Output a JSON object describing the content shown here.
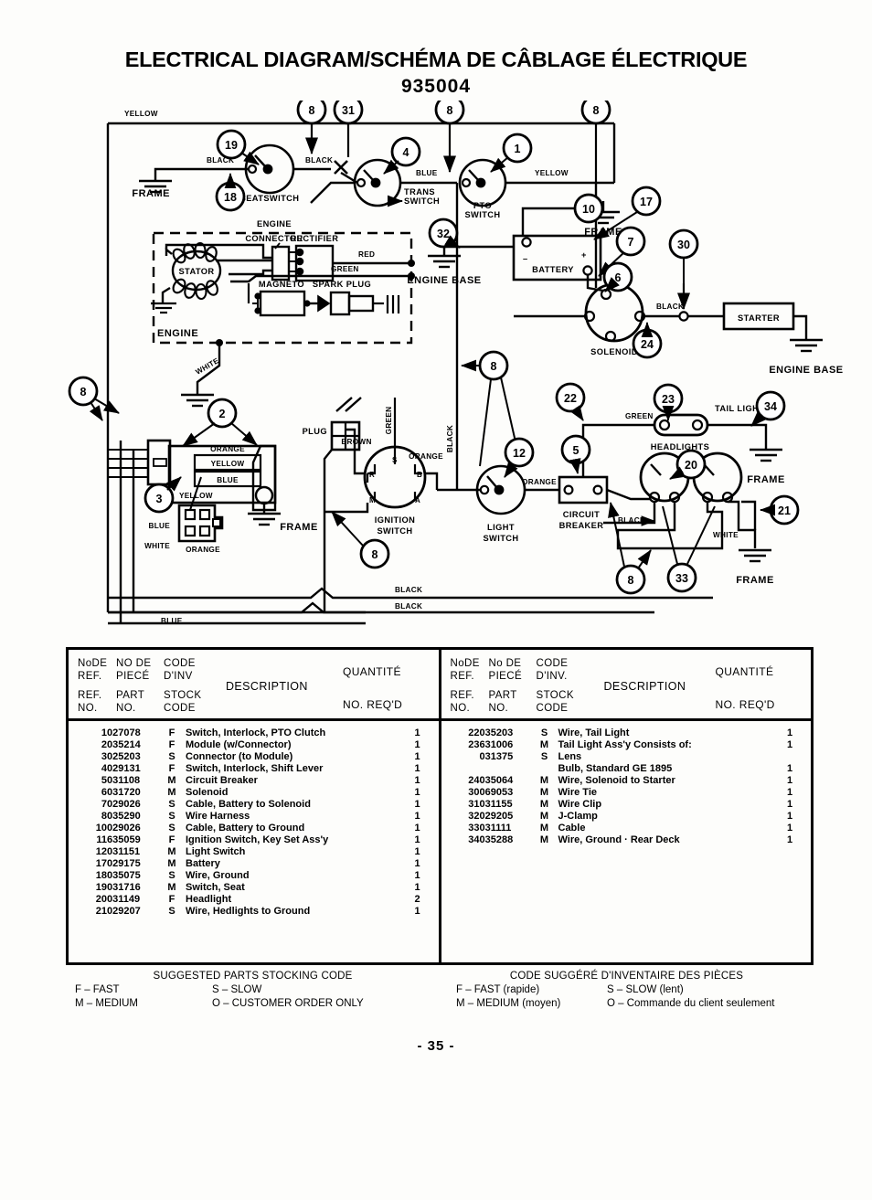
{
  "document": {
    "title": "ELECTRICAL DIAGRAM/SCHÉMA DE CÂBLAGE ÉLECTRIQUE",
    "number": "935004",
    "page_number": "- 35 -"
  },
  "diagram": {
    "components": [
      {
        "id": "seat-switch",
        "label": "SEATSWITCH"
      },
      {
        "id": "trans-switch",
        "label": "TRANS\nSWITCH"
      },
      {
        "id": "pto-switch",
        "label": "PTO\nSWITCH"
      },
      {
        "id": "battery",
        "label": "BATTERY"
      },
      {
        "id": "solenoid",
        "label": "SOLENOID"
      },
      {
        "id": "starter",
        "label": "STARTER"
      },
      {
        "id": "engine",
        "label": "ENGINE"
      },
      {
        "id": "engine-box",
        "label": "ENGINE"
      },
      {
        "id": "connector",
        "label": "CONNECTOR"
      },
      {
        "id": "rectifier",
        "label": "RECTIFIER"
      },
      {
        "id": "stator",
        "label": "STATOR"
      },
      {
        "id": "magneto",
        "label": "MAGNETO"
      },
      {
        "id": "spark-plug",
        "label": "SPARK PLUG"
      },
      {
        "id": "ignition-switch",
        "label": "IGNITION\nSWITCH"
      },
      {
        "id": "light-switch",
        "label": "LIGHT\nSWITCH"
      },
      {
        "id": "circuit-breaker",
        "label": "CIRCUIT\nBREAKER"
      },
      {
        "id": "tail-light",
        "label": "TAIL LIGHT"
      },
      {
        "id": "headlights",
        "label": "HEADLIGHTS"
      },
      {
        "id": "plug",
        "label": "PLUG"
      }
    ],
    "labels": {
      "frame": "FRAME",
      "engine_base": "ENGINE BASE",
      "yellow": "YELLOW",
      "black": "BLACK",
      "orange": "ORANGE",
      "blue": "BLUE",
      "red": "RED",
      "green": "GREEN",
      "white": "WHITE",
      "brown": "BROWN"
    },
    "ignition_terminals": [
      "R",
      "S",
      "B",
      "M",
      "A"
    ],
    "balloons": [
      "1",
      "2",
      "3",
      "4",
      "5",
      "6",
      "7",
      "8",
      "10",
      "12",
      "17",
      "18",
      "19",
      "20",
      "21",
      "22",
      "23",
      "24",
      "30",
      "31",
      "32",
      "33",
      "34"
    ]
  },
  "parts_table": {
    "headers": {
      "line1_col1": "NoDE",
      "line1_col2": "NO DE",
      "line1_col3": "CODE",
      "line2_col1": "REF.",
      "line2_col2": "PIECÉ",
      "line2_col3": "D'INV",
      "line3_col1": "REF.",
      "line3_col2": "PART",
      "line3_col3": "STOCK",
      "line4_col1": "NO.",
      "line4_col2": "NO.",
      "line4_col3": "CODE",
      "description": "DESCRIPTION",
      "quantite": "QUANTITÉ",
      "no_reqd": "NO. REQ'D"
    },
    "headers_right": {
      "line1_col1": "NoDE",
      "line1_col2": "No DE",
      "line1_col3": "CODE",
      "line2_col1": "REF.",
      "line2_col2": "PIECÉ",
      "line2_col3": "D'INV.",
      "line3_col1": "REF.",
      "line3_col2": "PART",
      "line3_col3": "STOCK",
      "line4_col1": "NO.",
      "line4_col2": "NO.",
      "line4_col3": "CODE",
      "description": "DESCRIPTION",
      "quantite": "QUANTITÉ",
      "no_reqd": "NO. REQ'D"
    },
    "left_rows": [
      {
        "ref": "1",
        "part": "027078",
        "code": "F",
        "desc": "Switch, Interlock, PTO Clutch",
        "qty": "1"
      },
      {
        "ref": "2",
        "part": "035214",
        "code": "F",
        "desc": "Module (w/Connector)",
        "qty": "1"
      },
      {
        "ref": "3",
        "part": "025203",
        "code": "S",
        "desc": "Connector (to Module)",
        "qty": "1"
      },
      {
        "ref": "4",
        "part": "029131",
        "code": "F",
        "desc": "Switch, Interlock, Shift Lever",
        "qty": "1"
      },
      {
        "ref": "5",
        "part": "031108",
        "code": "M",
        "desc": "Circuit Breaker",
        "qty": "1"
      },
      {
        "ref": "6",
        "part": "031720",
        "code": "M",
        "desc": "Solenoid",
        "qty": "1"
      },
      {
        "ref": "7",
        "part": "029026",
        "code": "S",
        "desc": "Cable, Battery to Solenoid",
        "qty": "1"
      },
      {
        "ref": "8",
        "part": "035290",
        "code": "S",
        "desc": "Wire Harness",
        "qty": "1"
      },
      {
        "ref": "10",
        "part": "029026",
        "code": "S",
        "desc": "Cable, Battery to Ground",
        "qty": "1"
      },
      {
        "ref": "11",
        "part": "635059",
        "code": "F",
        "desc": "Ignition Switch, Key Set Ass'y",
        "qty": "1"
      },
      {
        "ref": "12",
        "part": "031151",
        "code": "M",
        "desc": "Light Switch",
        "qty": "1"
      },
      {
        "ref": "17",
        "part": "029175",
        "code": "M",
        "desc": "Battery",
        "qty": "1"
      },
      {
        "ref": "18",
        "part": "035075",
        "code": "S",
        "desc": "Wire, Ground",
        "qty": "1"
      },
      {
        "ref": "19",
        "part": "031716",
        "code": "M",
        "desc": "Switch, Seat",
        "qty": "1"
      },
      {
        "ref": "20",
        "part": "031149",
        "code": "F",
        "desc": "Headlight",
        "qty": "2"
      },
      {
        "ref": "21",
        "part": "029207",
        "code": "S",
        "desc": "Wire, Hedlights to Ground",
        "qty": "1"
      }
    ],
    "right_rows": [
      {
        "ref": "22",
        "part": "035203",
        "code": "S",
        "desc": "Wire, Tail Light",
        "qty": "1"
      },
      {
        "ref": "23",
        "part": "631006",
        "code": "M",
        "desc": "Tail Light Ass'y Consists of:",
        "qty": "1"
      },
      {
        "ref": "",
        "part": "031375",
        "code": "S",
        "desc": "Lens",
        "qty": ""
      },
      {
        "ref": "",
        "part": "",
        "code": "",
        "desc": "Bulb, Standard GE 1895",
        "qty": "1"
      },
      {
        "ref": "24",
        "part": "035064",
        "code": "M",
        "desc": "Wire, Solenoid to Starter",
        "qty": "1"
      },
      {
        "ref": "30",
        "part": "069053",
        "code": "M",
        "desc": "Wire Tie",
        "qty": "1"
      },
      {
        "ref": "31",
        "part": "031155",
        "code": "M",
        "desc": "Wire Clip",
        "qty": "1"
      },
      {
        "ref": "32",
        "part": "029205",
        "code": "M",
        "desc": "J-Clamp",
        "qty": "1"
      },
      {
        "ref": "33",
        "part": "031111",
        "code": "M",
        "desc": "Cable",
        "qty": "1"
      },
      {
        "ref": "34",
        "part": "035288",
        "code": "M",
        "desc": "Wire, Ground · Rear Deck",
        "qty": "1"
      }
    ]
  },
  "legend": {
    "english": {
      "title": "SUGGESTED PARTS STOCKING CODE",
      "fast": "F  – FAST",
      "slow": "S  – SLOW",
      "medium": "M – MEDIUM",
      "order": "O – CUSTOMER ORDER ONLY"
    },
    "french": {
      "title": "CODE SUGGÉRÉ D'INVENTAIRE DES PIÈCES",
      "fast": "F  – FAST (rapide)",
      "slow": "S  – SLOW (lent)",
      "medium": "M – MEDIUM (moyen)",
      "order": "O – Commande du client seulement"
    }
  }
}
